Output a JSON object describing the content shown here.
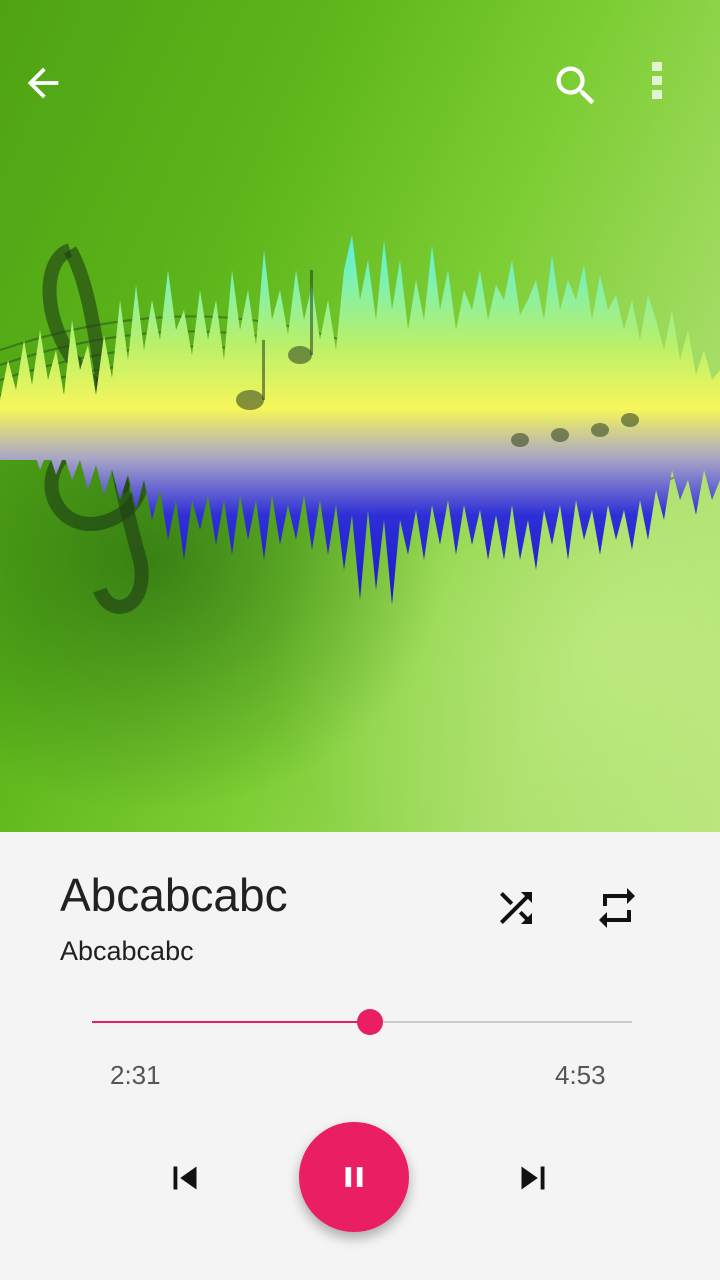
{
  "app": {
    "accent_color": "#e91e63"
  },
  "toolbar": {
    "back_icon": "arrow-back-icon",
    "search_icon": "search-icon",
    "menu_icon": "more-vert-icon"
  },
  "artwork": {
    "description_icon": "album-art-sound-wave"
  },
  "track": {
    "title": "Abcabcabc",
    "artist": "Abcabcabc"
  },
  "controls": {
    "shuffle_icon": "shuffle-icon",
    "repeat_icon": "repeat-icon",
    "previous_icon": "skip-previous-icon",
    "pause_icon": "pause-icon",
    "next_icon": "skip-next-icon"
  },
  "progress": {
    "elapsed": "2:31",
    "duration": "4:53",
    "fraction": 0.515
  }
}
